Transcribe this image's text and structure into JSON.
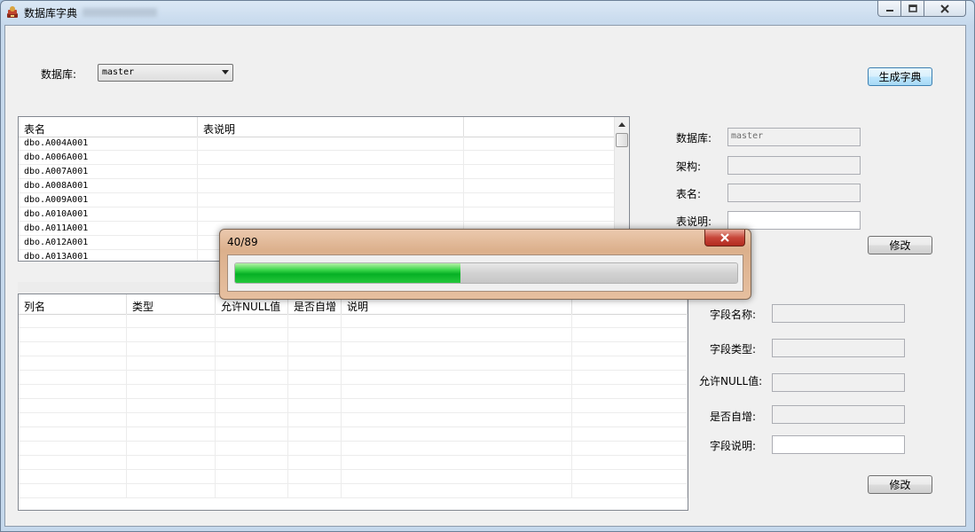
{
  "window": {
    "title": "数据库字典",
    "app_icon": "book-stack-icon",
    "controls": {
      "minimize": "minimize-icon",
      "maximize": "maximize-icon",
      "close": "close-icon"
    }
  },
  "database_selector": {
    "label": "数据库:",
    "selected": "master"
  },
  "generate_button": {
    "label": "生成字典"
  },
  "tables_grid": {
    "columns": [
      "表名",
      "表说明",
      ""
    ],
    "rows": [
      [
        "dbo.A004A001",
        "",
        ""
      ],
      [
        "dbo.A006A001",
        "",
        ""
      ],
      [
        "dbo.A007A001",
        "",
        ""
      ],
      [
        "dbo.A008A001",
        "",
        ""
      ],
      [
        "dbo.A009A001",
        "",
        ""
      ],
      [
        "dbo.A010A001",
        "",
        ""
      ],
      [
        "dbo.A011A001",
        "",
        ""
      ],
      [
        "dbo.A012A001",
        "",
        ""
      ],
      [
        "dbo.A013A001",
        "",
        ""
      ]
    ]
  },
  "table_info": {
    "database_label": "数据库:",
    "database_value": "master",
    "schema_label": "架构:",
    "schema_value": "",
    "table_name_label": "表名:",
    "table_name_value": "",
    "table_desc_label": "表说明:",
    "table_desc_value": "",
    "modify_label": "修改"
  },
  "columns_grid": {
    "columns": [
      "列名",
      "类型",
      "允许NULL值",
      "是否自增",
      "说明",
      ""
    ],
    "empty_rows": 13
  },
  "field_info": {
    "field_name_label": "字段名称:",
    "field_type_label": "字段类型:",
    "allow_null_label": "允许NULL值:",
    "auto_increment_label": "是否自增:",
    "field_desc_label": "字段说明:",
    "modify_label": "修改"
  },
  "progress_dialog": {
    "title": "40/89",
    "current": 40,
    "total": 89,
    "close_icon": "close-icon"
  }
}
